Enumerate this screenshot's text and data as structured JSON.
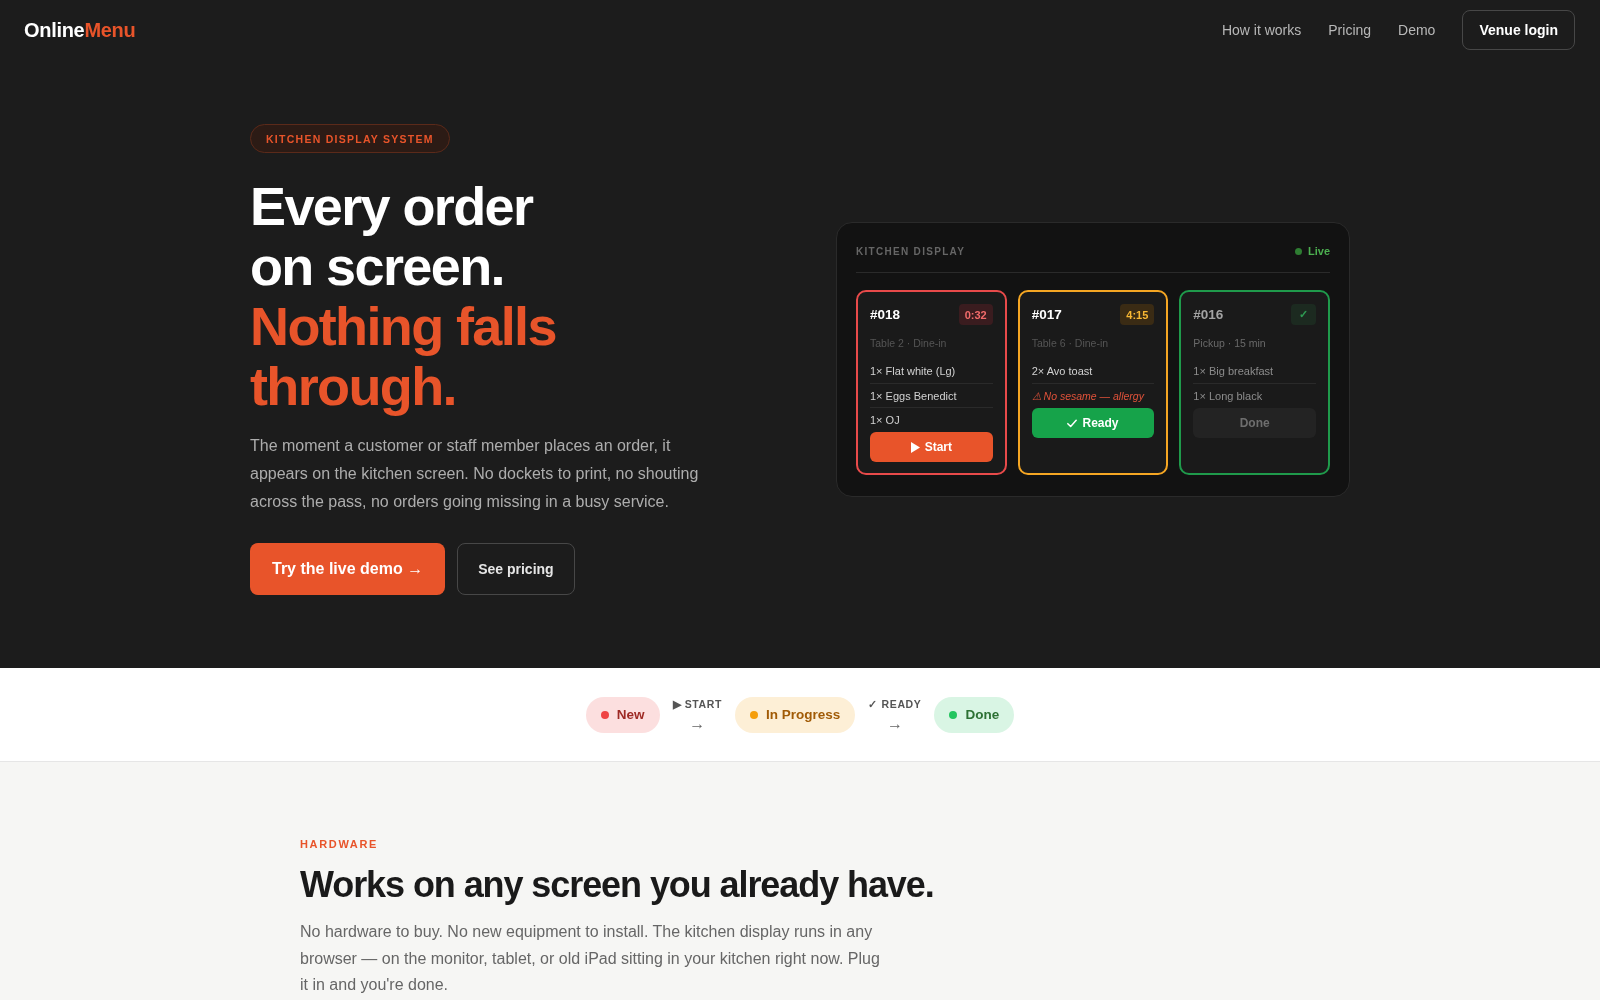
{
  "header": {
    "logo": {
      "text": "Online",
      "accent": "Menu"
    },
    "nav": [
      "How it works",
      "Pricing",
      "Demo"
    ],
    "login_button": "Venue login"
  },
  "hero": {
    "badge": "KITCHEN DISPLAY SYSTEM",
    "headline": {
      "lines": [
        "Every order",
        "on screen."
      ],
      "accent_lines": [
        "Nothing falls",
        "through."
      ]
    },
    "description": "The moment a customer or staff member places an order, it appears on the kitchen screen. No dockets to print, no shouting across the pass, no orders going missing in a busy service.",
    "buttons": [
      {
        "label": "Try the live demo →",
        "kind": "primary"
      },
      {
        "label": "See pricing",
        "kind": "secondary"
      }
    ]
  },
  "kitchen_display": {
    "title": "KITCHEN DISPLAY",
    "status": "Live",
    "tickets": [
      {
        "kind": "new",
        "number": "#018",
        "badge": "0:32",
        "details": "Table 2 · Dine-in",
        "items": [
          {
            "kind": "item",
            "text": "1× Flat white (Lg)"
          },
          {
            "kind": "item",
            "text": "1× Eggs Benedict"
          },
          {
            "kind": "item",
            "text": "1× OJ"
          }
        ],
        "action": {
          "label": "Start",
          "disabled": false
        }
      },
      {
        "kind": "in_progress",
        "number": "#017",
        "badge": "4:15",
        "details": "Table 6 · Dine-in",
        "items": [
          {
            "kind": "item",
            "text": "2× Avo toast"
          },
          {
            "kind": "note",
            "text": "⚠ No sesame — allergy"
          }
        ],
        "action": {
          "label": "Ready",
          "disabled": false
        }
      },
      {
        "kind": "done",
        "number": "#016",
        "badge": "✓",
        "details": "Pickup · 15 min",
        "items": [
          {
            "kind": "item",
            "text": "1× Big breakfast"
          },
          {
            "kind": "item",
            "text": "1× Long black"
          }
        ],
        "action": {
          "label": "Done",
          "disabled": true
        }
      }
    ]
  },
  "pipeline": [
    {
      "kind": "status",
      "label": "New",
      "color": "#ef4444"
    },
    {
      "kind": "transition",
      "label": "▶ START",
      "arrow": "→"
    },
    {
      "kind": "status",
      "label": "In Progress",
      "color": "#f59e0b"
    },
    {
      "kind": "transition",
      "label": "✓ READY",
      "arrow": "→"
    },
    {
      "kind": "status",
      "label": "Done",
      "color": "#22c55e"
    }
  ],
  "hardware": {
    "eyebrow": "HARDWARE",
    "heading": "Works on any screen you already have.",
    "description": "No hardware to buy. No new equipment to install. The kitchen display runs in any browser — on the monitor, tablet, or old iPad sitting in your kitchen right now. Plug it in and you're done."
  }
}
